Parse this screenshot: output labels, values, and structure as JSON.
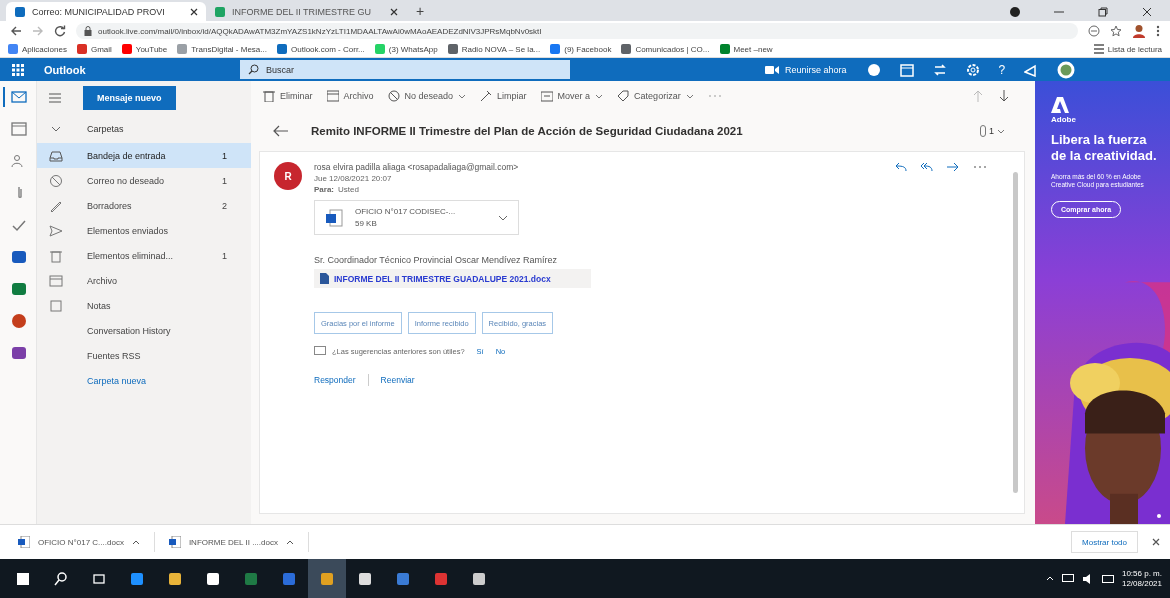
{
  "browser": {
    "tabs": [
      {
        "title": "Correo: MUNICIPALIDAD PROVI",
        "selected": true,
        "color": "#0f6cbd"
      },
      {
        "title": "INFORME DEL II TRIMESTRE GU",
        "selected": false,
        "color": "#1fa463"
      }
    ],
    "new_tab": "+",
    "url": "outlook.live.com/mail/0/inbox/id/AQQkADAwATM3ZmYAZS1kNzYzLTI1MDAALTAwAi0wMAoAEADEZdNlV3JPRsMqbNv0sktI",
    "bookmarks": [
      {
        "label": "Aplicaciones",
        "color": "#4285f4"
      },
      {
        "label": "Gmail",
        "color": "#d93025"
      },
      {
        "label": "YouTube",
        "color": "#ff0000"
      },
      {
        "label": "TransDigital - Mesa...",
        "color": "#9aa0a6"
      },
      {
        "label": "Outlook.com - Corr...",
        "color": "#0f6cbd"
      },
      {
        "label": "(3) WhatsApp",
        "color": "#25d366"
      },
      {
        "label": "Radio NOVA – Se la...",
        "color": "#5f6368"
      },
      {
        "label": "(9) Facebook",
        "color": "#1877f2"
      },
      {
        "label": "Comunicados | CO...",
        "color": "#5f6368"
      },
      {
        "label": "Meet –new",
        "color": "#00832d"
      }
    ],
    "reading_list": "Lista de lectura"
  },
  "outlook": {
    "app_name": "Outlook",
    "search": {
      "placeholder": "Buscar"
    },
    "meet_now": "Reunirse ahora",
    "help": "?",
    "new_message": "Mensaje nuevo",
    "folders_heading": "Carpetas",
    "folders": [
      {
        "label": "Bandeja de entrada",
        "count": "1",
        "selected": true
      },
      {
        "label": "Correo no deseado",
        "count": "1",
        "selected": false
      },
      {
        "label": "Borradores",
        "count": "2",
        "selected": false
      },
      {
        "label": "Elementos enviados",
        "selected": false
      },
      {
        "label": "Elementos eliminad...",
        "count": "1",
        "selected": false
      },
      {
        "label": "Archivo",
        "selected": false
      },
      {
        "label": "Notas",
        "selected": false
      },
      {
        "label": "Conversation History",
        "selected": false
      },
      {
        "label": "Fuentes RSS",
        "selected": false
      }
    ],
    "new_folder": "Carpeta nueva",
    "toolbar": [
      {
        "label": "Eliminar",
        "dropdown": false
      },
      {
        "label": "Archivo",
        "dropdown": false
      },
      {
        "label": "No deseado",
        "dropdown": true
      },
      {
        "label": "Limpiar",
        "dropdown": false
      },
      {
        "label": "Mover a",
        "dropdown": true
      },
      {
        "label": "Categorizar",
        "dropdown": true
      }
    ],
    "message": {
      "subject": "Remito INFORME II Trimestre del Plan de Acción de Seguridad Ciudadana 2021",
      "attachment_count": "1",
      "avatar": "R",
      "sender": "rosa elvira padilla aliaga <rosapadaliaga@gmail.com>",
      "date": "Jue 12/08/2021 20:07",
      "to_label": "Para:",
      "to": "Usted",
      "attachment": {
        "name": "OFICIO N°017 CODISEC-...",
        "size": "59 KB"
      },
      "body": "Sr. Coordinador Técnico Provincial Oscar Mendívez Ramírez",
      "link": "INFORME DEL II TRIMESTRE GUADALUPE 2021.docx",
      "suggested_replies": [
        "Gracias por el informe",
        "Informe recibido",
        "Recibido, gracias"
      ],
      "feedback": {
        "question": "¿Las sugerencias anteriores son útiles?",
        "yes": "Sí",
        "no": "No"
      },
      "actions": [
        "Responder",
        "Reenviar"
      ]
    }
  },
  "ad": {
    "kind": "picture",
    "brand": "Adobe",
    "headline": "Libera la fuerza de la creatividad.",
    "text": "Ahorra más del 60 % en Adobe Creative Cloud para estudiantes",
    "button": "Comprar ahora"
  },
  "downloads": {
    "items": [
      "OFICIO N°017 C....docx",
      "INFORME DEL II ....docx"
    ],
    "show_all": "Mostrar todo"
  },
  "taskbar": {
    "time": "10:56 p. m.",
    "date": "12/08/2021"
  }
}
